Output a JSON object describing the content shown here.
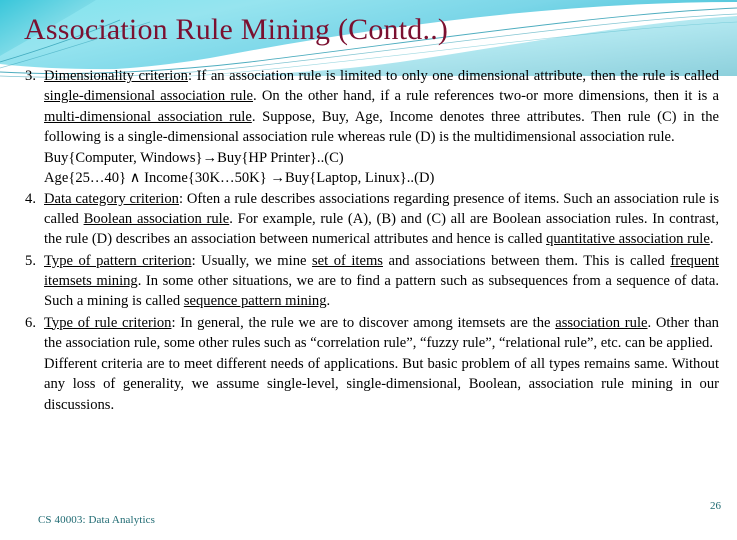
{
  "slide": {
    "title": "Association Rule Mining (Contd..)",
    "title_color": "#7b1030",
    "background_color": "#ffffff",
    "accent_color": "#3cc7d6",
    "footer_color": "#1f6a72"
  },
  "items": [
    {
      "number": "3.",
      "term": "Dimensionality criterion",
      "text_a": ": If an association rule is limited to only one dimensional attribute, then the rule is called ",
      "term_b": "single-dimensional association rule",
      "text_b": ". On the other hand, if a rule references two-or more dimensions, then it is a ",
      "term_c": "multi-dimensional association rule",
      "text_c": ". Suppose, Buy, Age, Income denotes three attributes. Then rule (C) in the following is a single-dimensional association rule whereas rule (D) is the multidimensional association rule.",
      "formula_1": "Buy{Computer, Windows}→Buy{HP Printer}..(C)",
      "formula_2": "Age{25…40} ∧ Income{30K…50K} →Buy{Laptop, Linux}..(D)"
    },
    {
      "number": "4.",
      "term": "Data category criterion",
      "text_a": ": Often a rule describes associations regarding presence of items. Such an association rule is called ",
      "term_b": "Boolean association rule",
      "text_b": ". For example, rule (A), (B) and (C) all are Boolean association rules. In contrast, the rule (D) describes an association between numerical attributes and hence is called ",
      "term_c": "quantitative association rule",
      "text_c": "."
    },
    {
      "number": "5.",
      "term": "Type of pattern criterion",
      "text_a": ": Usually, we mine ",
      "term_b": "set of items",
      "text_b": " and associations between them. This is called ",
      "term_c": "frequent itemsets mining",
      "text_c": ". In some other situations, we are to find a pattern such as subsequences from a sequence of data. Such a mining is called ",
      "term_d": "sequence pattern mining",
      "text_d": "."
    },
    {
      "number": "6.",
      "term": "Type of rule criterion",
      "text_a": ": In general, the rule we are to discover among itemsets are the ",
      "term_b": "association rule",
      "text_b": ". Other than the association rule, some other rules such as “correlation rule”, “fuzzy rule”, “relational rule”, etc. can be applied.",
      "closing_1": "Different criteria are to meet different needs of applications. But basic problem of all types remains same. Without any loss of generality, we assume single-level, single-dimensional, Boolean, association rule mining in our discussions."
    }
  ],
  "footer": {
    "course": "CS 40003: Data Analytics",
    "page_number": "26"
  }
}
